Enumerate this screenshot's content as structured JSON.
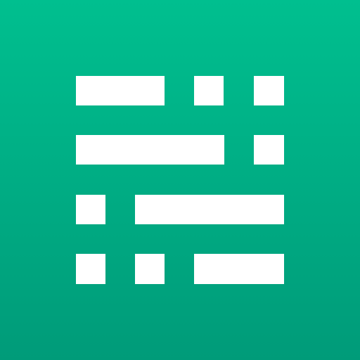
{
  "app_icon": {
    "icon_name": "grid-list-layout-icon",
    "background_top_color": "#00BF8F",
    "background_bottom_color": "#009B79",
    "glyph_color": "#FFFFFF"
  }
}
